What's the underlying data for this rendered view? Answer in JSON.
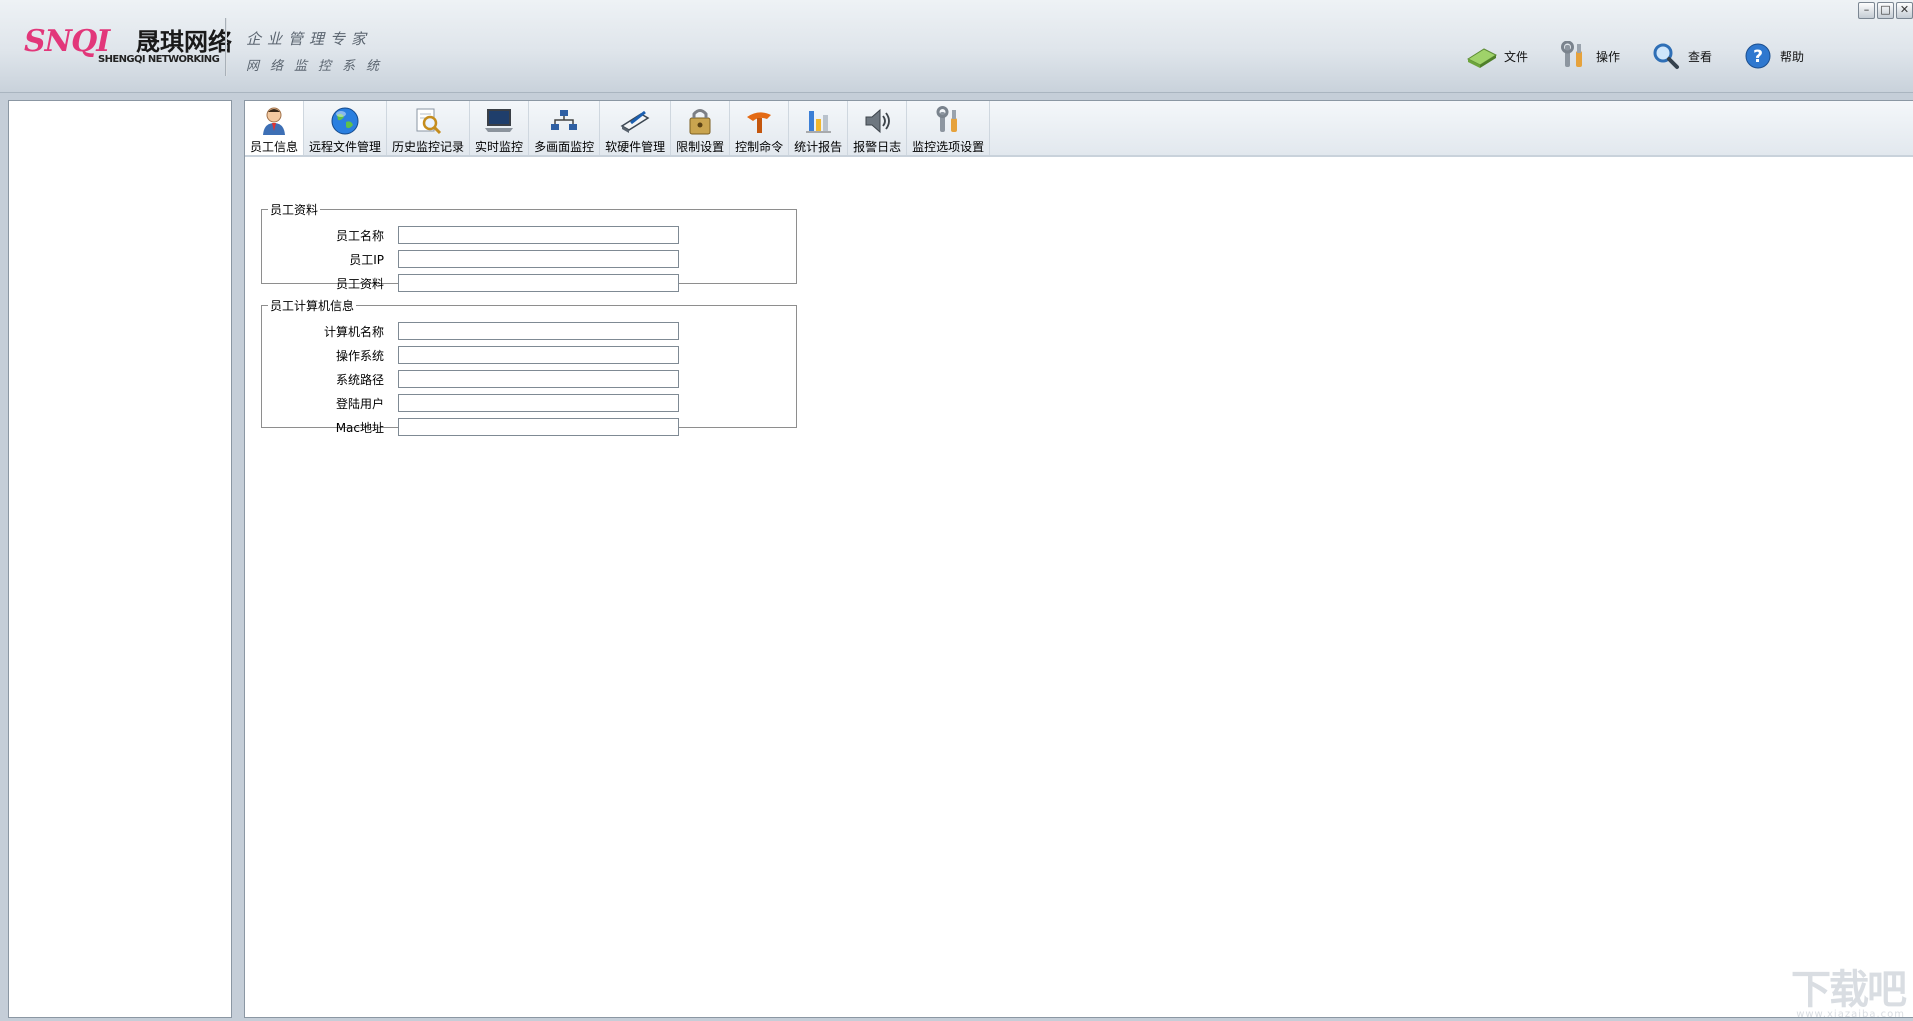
{
  "logo": {
    "mark": "SNQI",
    "name_cn": "晟琪网络",
    "name_en": "SHENGQI NETWORKING"
  },
  "slogan": {
    "line1": "企业管理专家",
    "line2": "网络监控系统"
  },
  "window_controls": {
    "minimize": "–",
    "maximize": "□",
    "close": "✕"
  },
  "menu": [
    {
      "id": "file",
      "label": "文件",
      "icon": "file-icon"
    },
    {
      "id": "operation",
      "label": "操作",
      "icon": "tools-icon"
    },
    {
      "id": "view",
      "label": "查看",
      "icon": "magnifier-icon"
    },
    {
      "id": "help",
      "label": "帮助",
      "icon": "help-icon"
    }
  ],
  "tabs": [
    {
      "id": "employee-info",
      "label": "员工信息",
      "icon": "user-icon",
      "active": true
    },
    {
      "id": "remote-file",
      "label": "远程文件管理",
      "icon": "globe-icon"
    },
    {
      "id": "history",
      "label": "历史监控记录",
      "icon": "search-document-icon"
    },
    {
      "id": "realtime",
      "label": "实时监控",
      "icon": "laptop-icon"
    },
    {
      "id": "multiscreen",
      "label": "多画面监控",
      "icon": "network-icon"
    },
    {
      "id": "software",
      "label": "软硬件管理",
      "icon": "edit-icon"
    },
    {
      "id": "restriction",
      "label": "限制设置",
      "icon": "lock-icon"
    },
    {
      "id": "control",
      "label": "控制命令",
      "icon": "command-icon"
    },
    {
      "id": "report",
      "label": "统计报告",
      "icon": "chart-icon"
    },
    {
      "id": "alarm",
      "label": "报警日志",
      "icon": "speaker-icon"
    },
    {
      "id": "options",
      "label": "监控选项设置",
      "icon": "settings-tools-icon"
    }
  ],
  "employee_section": {
    "legend": "员工资料",
    "fields": [
      {
        "label": "员工名称",
        "value": ""
      },
      {
        "label": "员工IP",
        "value": ""
      },
      {
        "label": "员工资料",
        "value": ""
      }
    ]
  },
  "computer_section": {
    "legend": "员工计算机信息",
    "fields": [
      {
        "label": "计算机名称",
        "value": ""
      },
      {
        "label": "操作系统",
        "value": ""
      },
      {
        "label": "系统路径",
        "value": ""
      },
      {
        "label": "登陆用户",
        "value": ""
      },
      {
        "label": "Mac地址",
        "value": ""
      }
    ]
  },
  "watermark": {
    "text": "下载吧",
    "sub": "www.xiazaiba.com"
  }
}
